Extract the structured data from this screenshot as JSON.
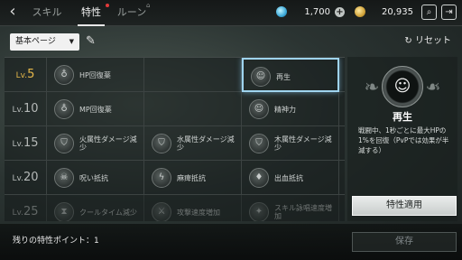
{
  "header": {
    "tabs": [
      {
        "label": "スキル"
      },
      {
        "label": "特性"
      },
      {
        "label": "ルーン"
      }
    ],
    "gems": "1,700",
    "gold": "20,935"
  },
  "toolbar": {
    "page_select": "基本ページ",
    "reset_label": "リセット"
  },
  "grid": {
    "rows": [
      {
        "level_prefix": "Lv.",
        "level": "5",
        "cells": [
          "HP回復薬",
          "",
          "再生"
        ]
      },
      {
        "level_prefix": "Lv.",
        "level": "10",
        "cells": [
          "MP回復薬",
          "",
          "精神力"
        ]
      },
      {
        "level_prefix": "Lv.",
        "level": "15",
        "cells": [
          "火属性ダメージ減少",
          "水属性ダメージ減少",
          "木属性ダメージ減少"
        ]
      },
      {
        "level_prefix": "Lv.",
        "level": "20",
        "cells": [
          "呪い抵抗",
          "麻痺抵抗",
          "出血抵抗"
        ]
      },
      {
        "level_prefix": "Lv.",
        "level": "25",
        "cells": [
          "クールタイム減少",
          "攻撃速度増加",
          "スキル詠唱速度増加"
        ]
      }
    ]
  },
  "detail": {
    "title": "再生",
    "description": "戦闘中、1秒ごとに最大HPの1%を回復（PvPでは効果が半減する）",
    "apply_label": "特性適用"
  },
  "footer": {
    "remaining": "残りの特性ポイント：1",
    "save_label": "保存"
  },
  "colors": {
    "selected_border": "#9fd4ef",
    "current_level": "#e6b84a",
    "notification": "#e23a3a"
  }
}
